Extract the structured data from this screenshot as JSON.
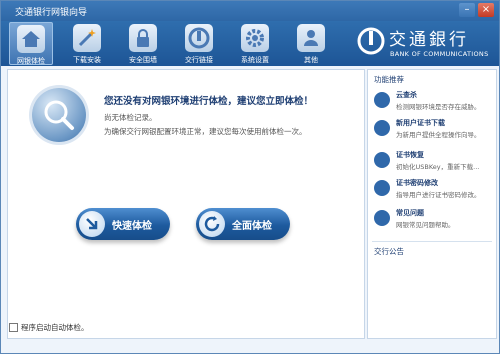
{
  "window": {
    "title": "交通银行网银向导",
    "minimize": "–",
    "close": "×"
  },
  "toolbar": {
    "items": [
      {
        "label": "网银体检",
        "icon": "house-icon",
        "active": true
      },
      {
        "label": "下载安装",
        "icon": "magic-wand-icon"
      },
      {
        "label": "安全围墙",
        "icon": "lock-icon"
      },
      {
        "label": "交行链接",
        "icon": "bank-logo-icon"
      },
      {
        "label": "系统设置",
        "icon": "gear-icon"
      },
      {
        "label": "其他",
        "icon": "person-icon"
      }
    ]
  },
  "brand": {
    "name_cn": "交通銀行",
    "name_en": "BANK OF COMMUNICATIONS"
  },
  "main": {
    "heading": "您还没有对网银环境进行体检，建议您立即体检！",
    "no_record": "尚无体检记录。",
    "advice": "为确保交行网银配置环境正常，建议您每次使用前体检一次。",
    "quick_check": "快速体检",
    "full_check": "全面体检"
  },
  "sidebar": {
    "title": "功能推荐",
    "features": [
      {
        "title": "云查杀",
        "desc": "检测网银环境是否存在威胁。",
        "icon": "shield-icon"
      },
      {
        "title": "新用户证书下载",
        "desc": "为新用户提供全程操作向导。",
        "icon": "certificate-icon"
      },
      {
        "title": "证书恢复",
        "desc": "初始化USBKey，重新下载...",
        "icon": "restore-icon"
      },
      {
        "title": "证书密码修改",
        "desc": "指导用户进行证书密码修改。",
        "icon": "mouse-icon"
      },
      {
        "title": "常见问题",
        "desc": "网银常见问题帮助。",
        "icon": "question-icon"
      }
    ],
    "announcement": "交行公告"
  },
  "footer": {
    "autostart_label": "程序启动自动体检。",
    "autostart_checked": false
  }
}
